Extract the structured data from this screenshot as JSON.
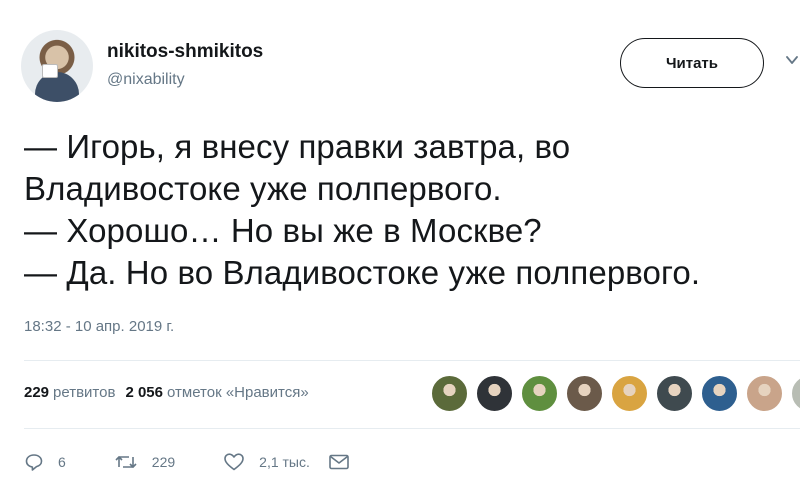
{
  "user": {
    "display_name": "nikitos-shmikitos",
    "handle": "@nixability"
  },
  "follow_button": {
    "label": "Читать"
  },
  "tweet": {
    "lines": [
      "— Игорь, я внесу правки завтра, во",
      "Владивостоке уже полпервого.",
      "— Хорошо… Но вы же в Москве?",
      "— Да. Но во Владивостоке уже полпервого."
    ],
    "timestamp": "18:32 - 10 апр. 2019 г."
  },
  "stats": {
    "retweets_count": "229",
    "retweets_label": "ретвитов",
    "likes_count": "2 056",
    "likes_label": "отметок «Нравится»"
  },
  "likers": [
    {
      "name": "liker-1",
      "color": "#5b6a3a"
    },
    {
      "name": "liker-2",
      "color": "#2f3338"
    },
    {
      "name": "liker-3",
      "color": "#5f8f3f"
    },
    {
      "name": "liker-4",
      "color": "#6b5a4a"
    },
    {
      "name": "liker-5",
      "color": "#d9a441"
    },
    {
      "name": "liker-6",
      "color": "#3f4a4f"
    },
    {
      "name": "liker-7",
      "color": "#2e5f8f"
    },
    {
      "name": "liker-8",
      "color": "#c9a48a"
    },
    {
      "name": "liker-9",
      "color": "#b8bdb4"
    }
  ],
  "actions": {
    "replies_count": "6",
    "retweets_count": "229",
    "likes_count": "2,1 тыс."
  },
  "icons": {
    "reply": "reply-icon",
    "retweet": "retweet-icon",
    "like": "heart-icon",
    "message": "mail-icon",
    "more": "chevron-down-icon"
  },
  "colors": {
    "text": "#14171a",
    "secondary": "#657786",
    "divider": "#e6ecf0"
  }
}
